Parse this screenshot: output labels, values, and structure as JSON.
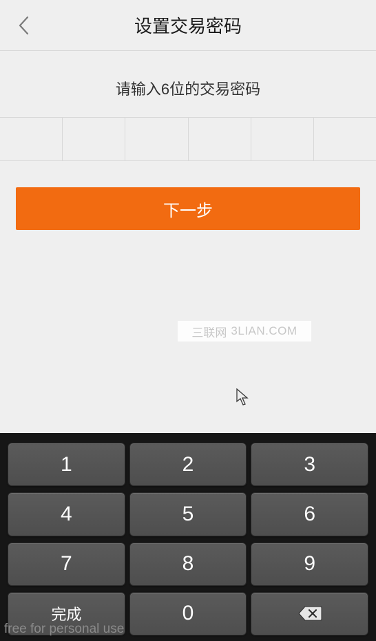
{
  "header": {
    "title": "设置交易密码"
  },
  "prompt": "请输入6位的交易密码",
  "nextButton": "下一步",
  "watermark": {
    "cn": "三联网",
    "en": "3LIAN.COM"
  },
  "keypad": {
    "keys": [
      "1",
      "2",
      "3",
      "4",
      "5",
      "6",
      "7",
      "8",
      "9"
    ],
    "done": "完成",
    "zero": "0"
  },
  "footer": "free for personal use"
}
